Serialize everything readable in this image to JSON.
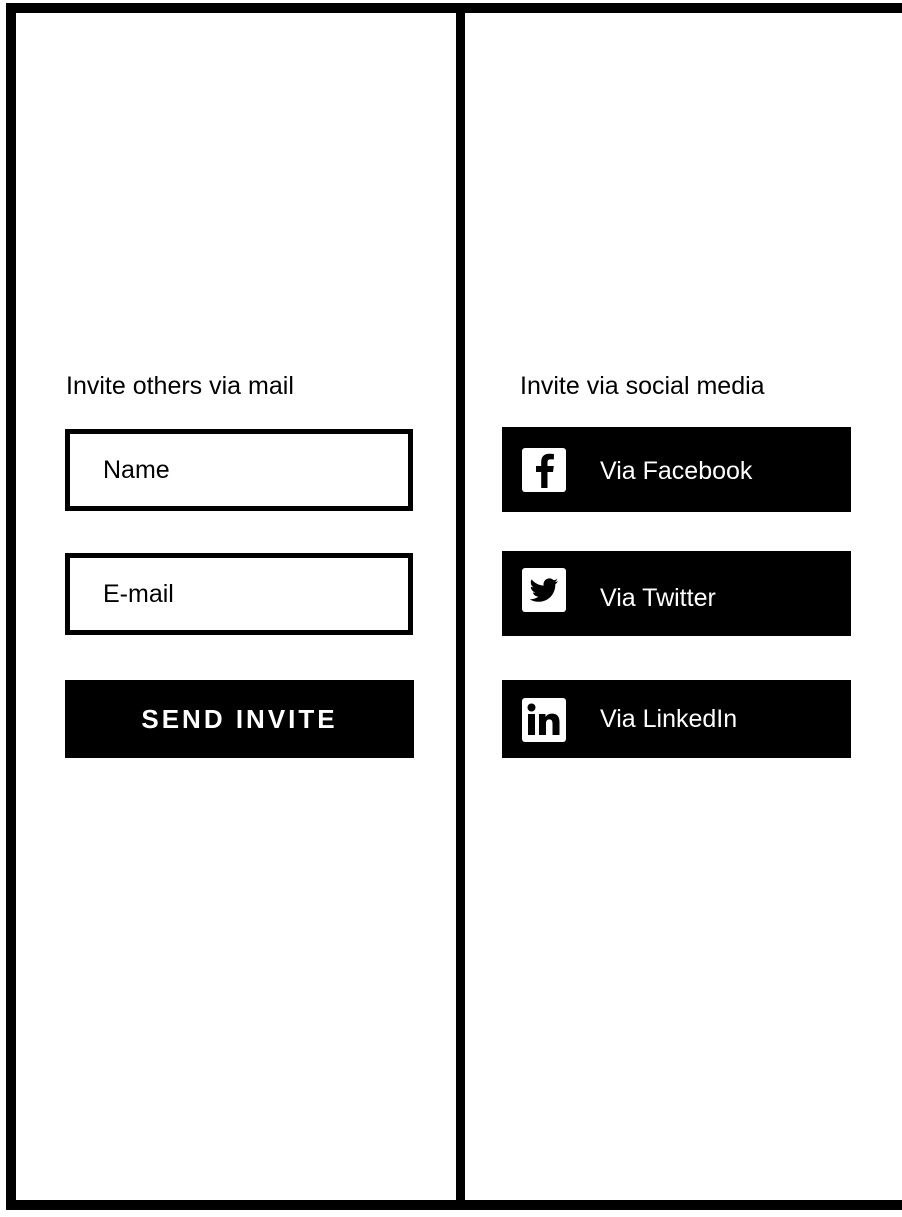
{
  "mail_invite": {
    "heading": "Invite others via mail",
    "name_field": {
      "placeholder": "Name",
      "value": ""
    },
    "email_field": {
      "placeholder": "E-mail",
      "value": ""
    },
    "send_button_label": "SEND INVITE"
  },
  "social_invite": {
    "heading": "Invite via social media",
    "buttons": [
      {
        "label": "Via Facebook",
        "icon": "facebook-icon"
      },
      {
        "label": "Via Twitter",
        "icon": "twitter-icon"
      },
      {
        "label": "Via LinkedIn",
        "icon": "linkedin-icon"
      }
    ]
  },
  "colors": {
    "border": "#000000",
    "button_background": "#000000",
    "button_text": "#ffffff",
    "background": "#ffffff"
  }
}
